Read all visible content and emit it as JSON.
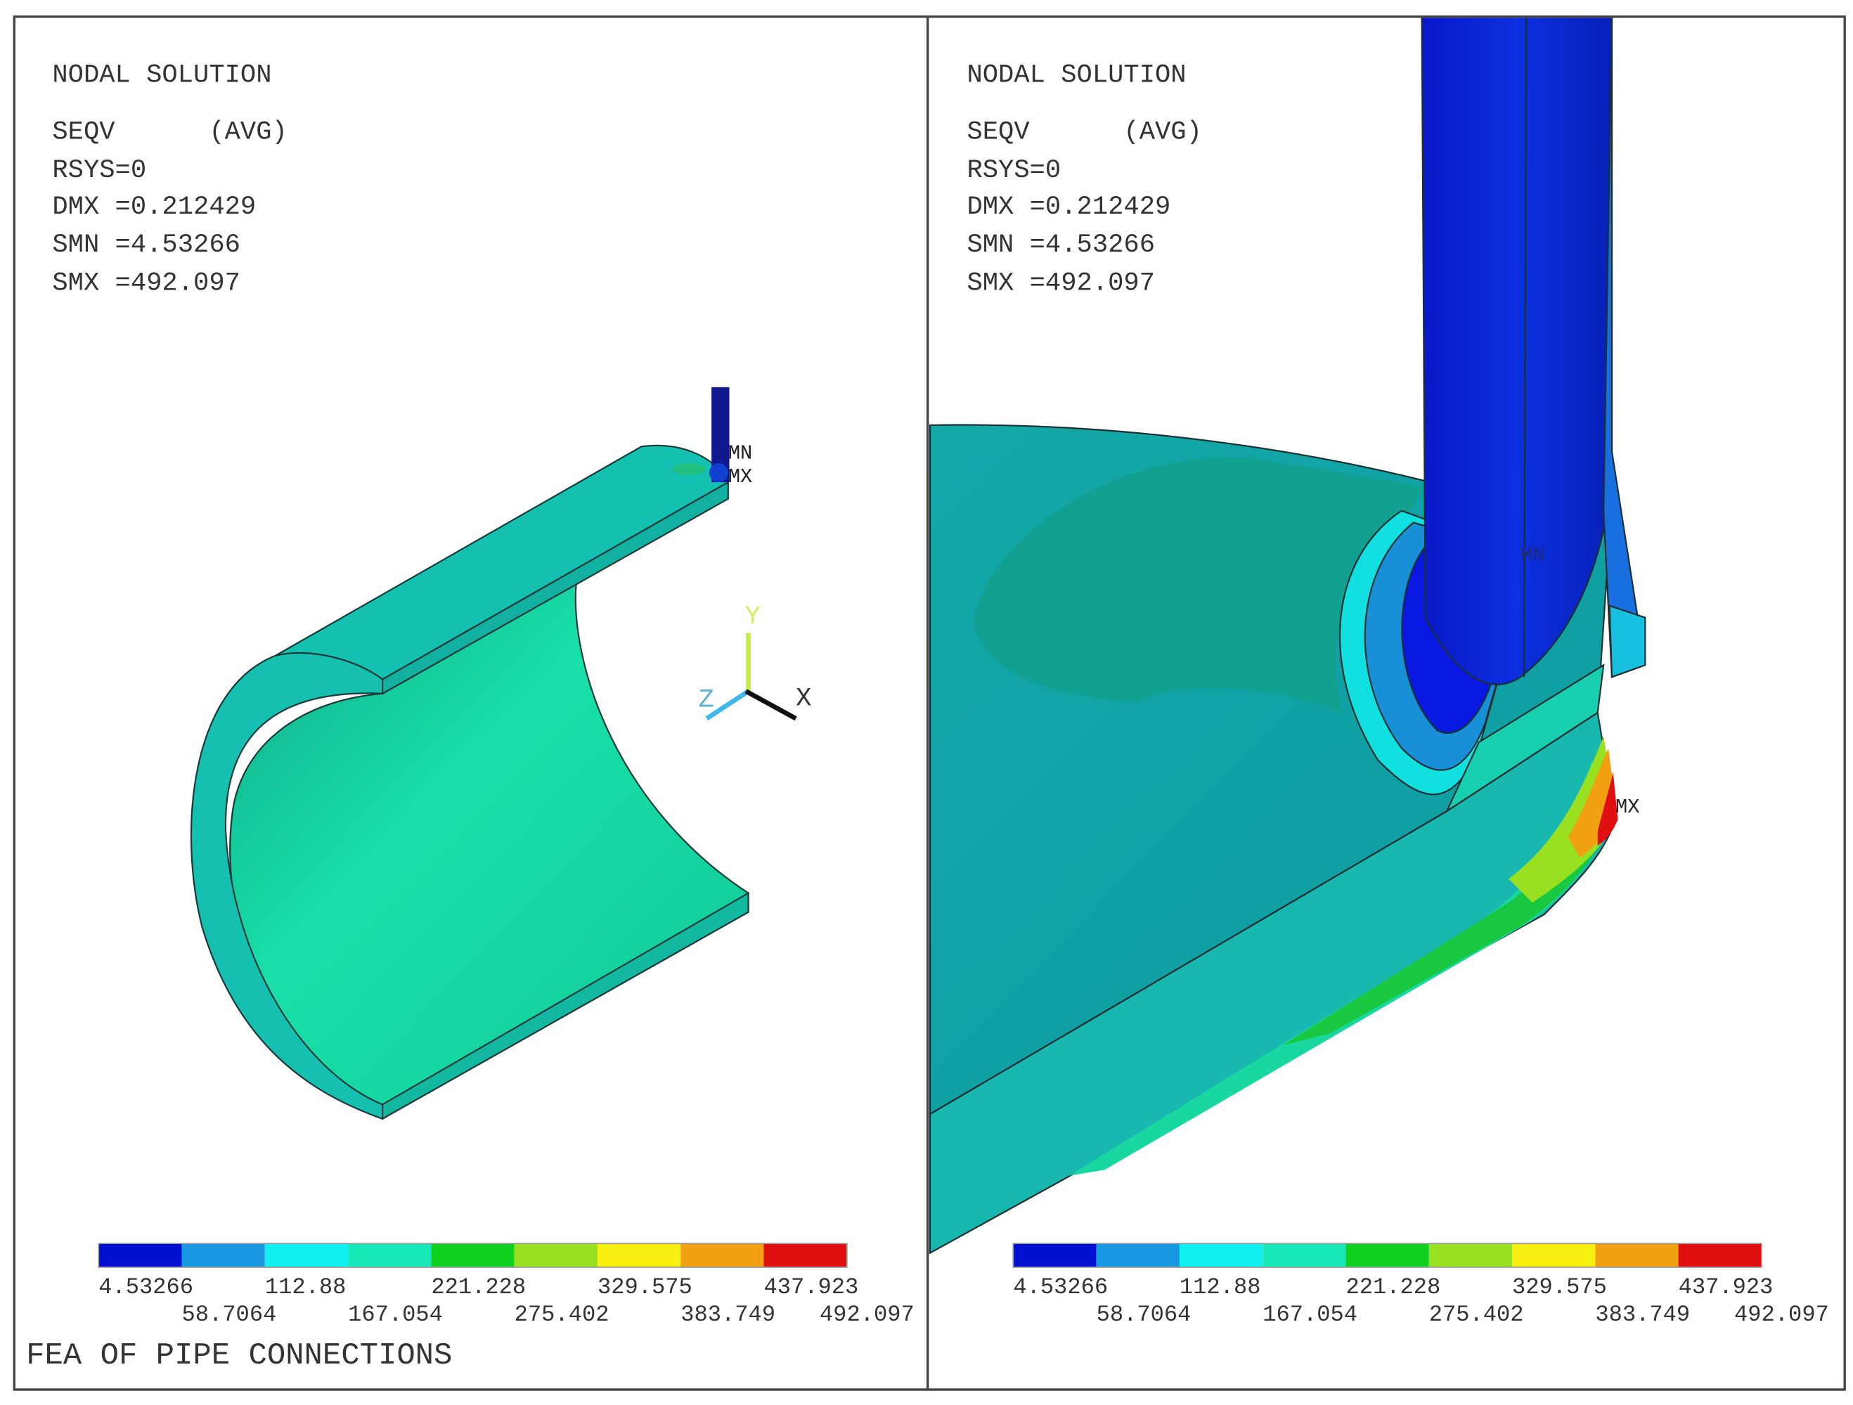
{
  "panels": [
    {
      "header": [
        "NODAL SOLUTION",
        "SEQV      (AVG)",
        "RSYS=0",
        "DMX =0.212429",
        "SMN =4.53266",
        "SMX =492.097"
      ],
      "markers": {
        "min": "MN",
        "max": "MX"
      },
      "axes": {
        "x": "X",
        "y": "Y",
        "z": "Z"
      }
    },
    {
      "header": [
        "NODAL SOLUTION",
        "SEQV      (AVG)",
        "RSYS=0",
        "DMX =0.212429",
        "SMN =4.53266",
        "SMX =492.097"
      ],
      "markers": {
        "min": "MN",
        "max": "MX"
      }
    }
  ],
  "legend": {
    "values": [
      "4.53266",
      "58.7064",
      "112.88",
      "167.054",
      "221.228",
      "275.402",
      "329.575",
      "383.749",
      "437.923",
      "492.097"
    ],
    "colors": [
      "#0010d0",
      "#1898e0",
      "#10f0f0",
      "#18e8b8",
      "#10d020",
      "#98e020",
      "#f8f010",
      "#f0a010",
      "#e01010"
    ]
  },
  "title": "FEA OF PIPE CONNECTIONS"
}
